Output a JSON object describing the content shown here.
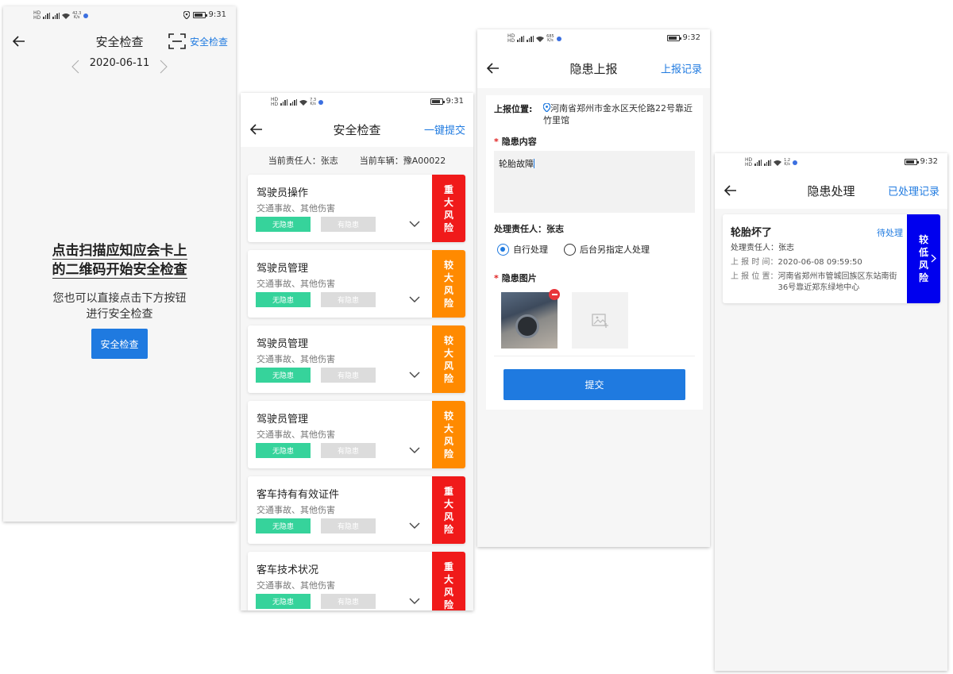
{
  "status": {
    "s1": {
      "net_speed": "42.3",
      "net_unit": "K/s",
      "time": "9:31"
    },
    "s2": {
      "net_speed": "7.3",
      "net_unit": "K/s",
      "time": "9:31"
    },
    "s3": {
      "net_speed": "685",
      "net_unit": "K/s",
      "time": "9:32"
    },
    "s4": {
      "net_speed": "1.2",
      "net_unit": "K/s",
      "time": "9:32"
    }
  },
  "screen1": {
    "title": "安全检查",
    "scan_label": "安全检查",
    "date": "2020-06-11",
    "prompt_line1": "点击扫描应知应会卡上",
    "prompt_line2": "的二维码开始安全检查",
    "hint_line1": "您也可以直接点击下方按钮",
    "hint_line2": "进行安全检查",
    "button": "安全检查"
  },
  "screen2": {
    "title": "安全检查",
    "action": "一键提交",
    "person_label": "当前责任人：张志",
    "vehicle_label": "当前车辆：豫A00022",
    "no_hazard": "无隐患",
    "has_hazard": "有隐患",
    "items": [
      {
        "title": "驾驶员操作",
        "sub": "交通事故、其他伤害",
        "risk": "重大风险",
        "risk_color": "#f01a1a"
      },
      {
        "title": "驾驶员管理",
        "sub": "交通事故、其他伤害",
        "risk": "较大风险",
        "risk_color": "#ff8a00"
      },
      {
        "title": "驾驶员管理",
        "sub": "交通事故、其他伤害",
        "risk": "较大风险",
        "risk_color": "#ff8a00"
      },
      {
        "title": "驾驶员管理",
        "sub": "交通事故、其他伤害",
        "risk": "较大风险",
        "risk_color": "#ff8a00"
      },
      {
        "title": "客车持有有效证件",
        "sub": "交通事故、其他伤害",
        "risk": "重大风险",
        "risk_color": "#f01a1a"
      },
      {
        "title": "客车技术状况",
        "sub": "交通事故、其他伤害",
        "risk": "重大风险",
        "risk_color": "#f01a1a"
      }
    ]
  },
  "screen3": {
    "title": "隐患上报",
    "action": "上报记录",
    "location_label": "上报位置:",
    "location_value": "河南省郑州市金水区天伦路22号靠近竹里馆",
    "content_label": "隐患内容",
    "content_value": "轮胎故障",
    "handler_label": "处理责任人：张志",
    "option_self": "自行处理",
    "option_backend": "后台另指定人处理",
    "photo_label": "隐患图片",
    "submit": "提交"
  },
  "screen4": {
    "title": "隐患处理",
    "action": "已处理记录",
    "card": {
      "title": "轮胎坏了",
      "status": "待处理",
      "handler": "处理责任人：张志",
      "time_label": "上 报 时 间：",
      "time_value": "2020-06-08 09:59:50",
      "loc_label": "上 报 位 置：",
      "loc_value": "河南省郑州市管城回族区东站南街36号靠近郑东绿地中心",
      "risk": "较低风险"
    }
  }
}
